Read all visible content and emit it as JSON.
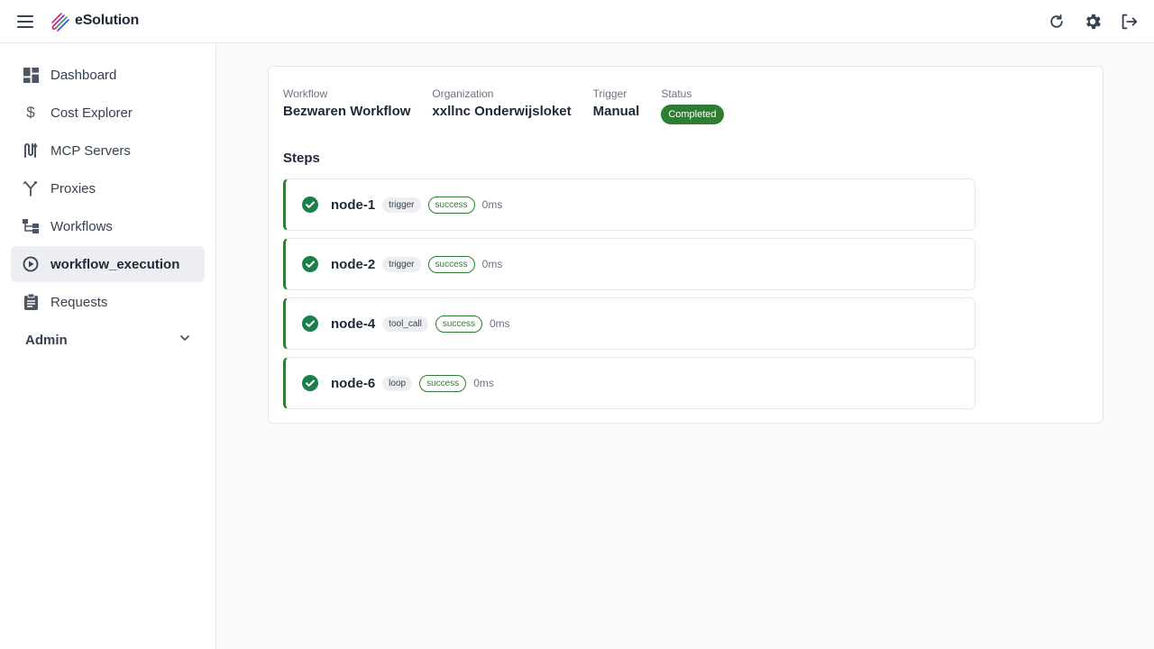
{
  "app": {
    "brand": "eSolution"
  },
  "header": {
    "icons": [
      "refresh-icon",
      "gear-icon",
      "logout-icon"
    ]
  },
  "sidebar": {
    "items": [
      {
        "label": "Dashboard",
        "icon": "dashboard-icon"
      },
      {
        "label": "Cost Explorer",
        "icon": "dollar-icon"
      },
      {
        "label": "MCP Servers",
        "icon": "mcp-icon"
      },
      {
        "label": "Proxies",
        "icon": "fork-icon"
      },
      {
        "label": "Workflows",
        "icon": "workflow-icon"
      },
      {
        "label": "workflow_execution",
        "icon": "play-circle-icon",
        "active": true
      },
      {
        "label": "Requests",
        "icon": "clipboard-icon"
      }
    ],
    "admin_label": "Admin"
  },
  "execution": {
    "workflow_label": "Workflow",
    "workflow_value": "Bezwaren Workflow",
    "organization_label": "Organization",
    "organization_value": "xxllnc Onderwijsloket",
    "trigger_label": "Trigger",
    "trigger_value": "Manual",
    "status_label": "Status",
    "status_value": "Completed"
  },
  "steps_title": "Steps",
  "steps": [
    {
      "name": "node-1",
      "type": "trigger",
      "status": "success",
      "duration": "0ms"
    },
    {
      "name": "node-2",
      "type": "trigger",
      "status": "success",
      "duration": "0ms"
    },
    {
      "name": "node-4",
      "type": "tool_call",
      "status": "success",
      "duration": "0ms"
    },
    {
      "name": "node-6",
      "type": "loop",
      "status": "success",
      "duration": "0ms"
    }
  ],
  "colors": {
    "success": "#2e7d32",
    "accent_step": "#1a7f4b",
    "active_nav": "#eceef1"
  }
}
